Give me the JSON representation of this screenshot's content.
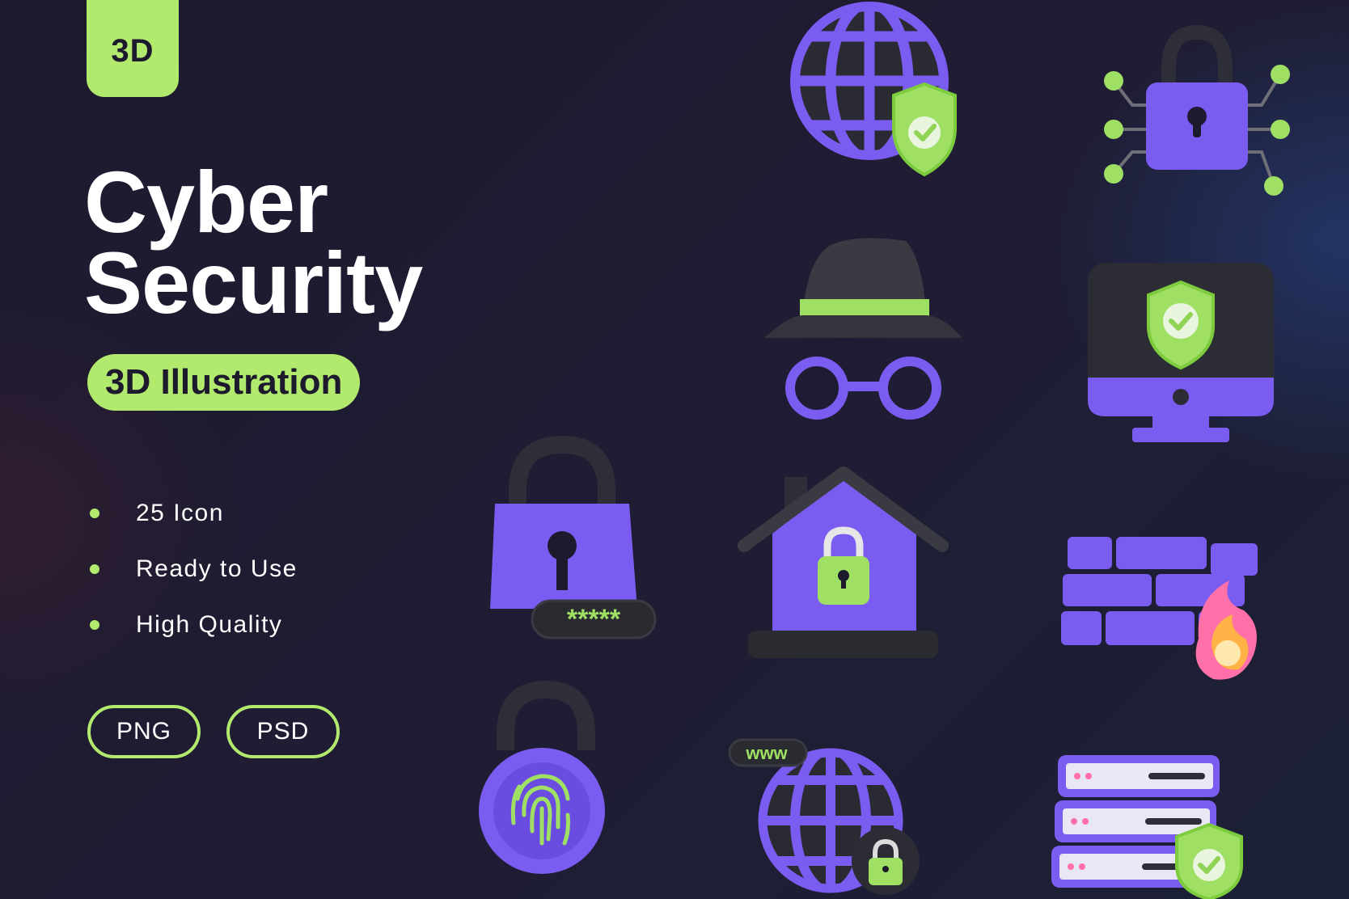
{
  "badge": {
    "label": "3D"
  },
  "title": {
    "line1": "Cyber",
    "line2": "Security"
  },
  "subtitle": "3D Illustration",
  "features": [
    "25 Icon",
    "Ready to Use",
    "High Quality"
  ],
  "formats": [
    "PNG",
    "PSD"
  ],
  "icon_labels": {
    "password": "*****",
    "www": "www"
  },
  "icons": [
    "globe-shield-icon",
    "lock-network-icon",
    "spy-hat-glasses-icon",
    "monitor-shield-icon",
    "padlock-password-icon",
    "house-lock-icon",
    "firewall-icon",
    "fingerprint-lock-icon",
    "www-globe-lock-icon",
    "server-shield-icon"
  ],
  "colors": {
    "background": "#1d1a2e",
    "accent_green": "#b2ea6e",
    "purple": "#7b5cf0",
    "dark": "#2b2b33",
    "white": "#ffffff"
  }
}
